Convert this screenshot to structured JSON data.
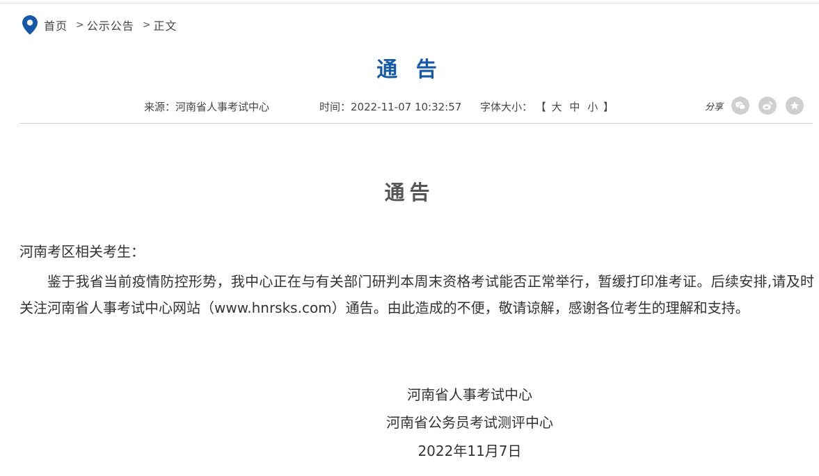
{
  "breadcrumb": {
    "home": "首页",
    "separator": ">",
    "section": "公示公告",
    "current": "正文",
    "icon": "location-pin-icon",
    "icon_color": "#1659a8"
  },
  "header": {
    "title": "通 告",
    "title_color": "#1659a8"
  },
  "meta": {
    "source": "来源：河南省人事考试中心",
    "time": "时间：2022-11-07 10:32:57",
    "font_size_label": "字体大小：",
    "bracket_open": "【",
    "bracket_close": "】",
    "font_size_options": [
      "大",
      "中",
      "小"
    ]
  },
  "share": {
    "label": "分享",
    "buttons": [
      "wechat-icon",
      "weibo-icon",
      "favorite-star-icon"
    ]
  },
  "article": {
    "title": "通告",
    "salutation": "河南考区相关考生：",
    "paragraph": "鉴于我省当前疫情防控形势，我中心正在与有关部门研判本周末资格考试能否正常举行，暂缓打印准考证。后续安排,请及时关注河南省人事考试中心网站（www.hnrsks.com）通告。由此造成的不便，敬请谅解，感谢各位考生的理解和支持。",
    "signature_1": "河南省人事考试中心",
    "signature_2": "河南省公务员考试测评中心",
    "date": "2022年11月7日"
  }
}
